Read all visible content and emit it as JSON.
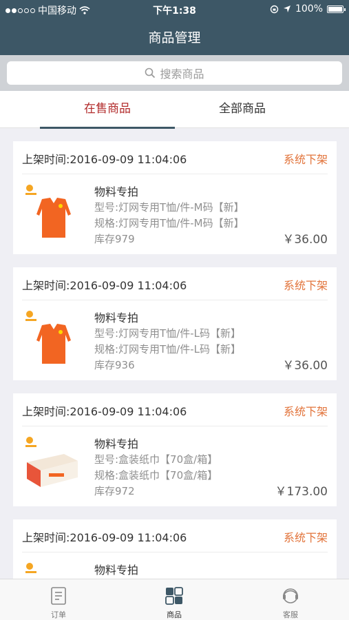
{
  "status_bar": {
    "carrier": "中国移动",
    "time": "下午1:38",
    "battery": "100%"
  },
  "nav": {
    "title": "商品管理"
  },
  "search": {
    "placeholder": "搜索商品"
  },
  "tabs": [
    {
      "label": "在售商品",
      "active": true
    },
    {
      "label": "全部商品",
      "active": false
    }
  ],
  "products": [
    {
      "listed_time": "上架时间:2016-09-09 11:04:06",
      "action": "系统下架",
      "name": "物料专拍",
      "model": "型号:灯网专用T恤/件-M码【新】",
      "spec": "规格:灯网专用T恤/件-M码【新】",
      "stock": "库存979",
      "price": "￥36.00",
      "image": "orange-tshirt"
    },
    {
      "listed_time": "上架时间:2016-09-09 11:04:06",
      "action": "系统下架",
      "name": "物料专拍",
      "model": "型号:灯网专用T恤/件-L码【新】",
      "spec": "规格:灯网专用T恤/件-L码【新】",
      "stock": "库存936",
      "price": "￥36.00",
      "image": "orange-tshirt"
    },
    {
      "listed_time": "上架时间:2016-09-09 11:04:06",
      "action": "系统下架",
      "name": "物料专拍",
      "model": "型号:盒装纸巾【70盒/箱】",
      "spec": "规格:盒装纸巾【70盒/箱】",
      "stock": "库存972",
      "price": "￥173.00",
      "image": "tissue-box"
    },
    {
      "listed_time": "上架时间:2016-09-09 11:04:06",
      "action": "系统下架",
      "name": "物料专拍",
      "model": "",
      "spec": "",
      "stock": "",
      "price": "",
      "image": "product-partial"
    }
  ],
  "tabbar": [
    {
      "label": "订单",
      "icon": "order-icon",
      "active": false
    },
    {
      "label": "商品",
      "icon": "goods-icon",
      "active": true
    },
    {
      "label": "客服",
      "icon": "service-icon",
      "active": false
    }
  ],
  "colors": {
    "header": "#3d5766",
    "accent_red": "#b22b2b",
    "action_orange": "#e2733a"
  }
}
